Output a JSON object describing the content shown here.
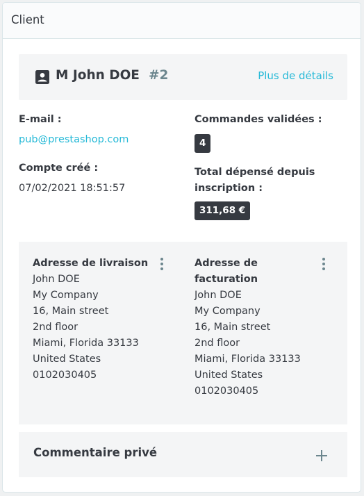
{
  "header": {
    "title": "Client"
  },
  "customer": {
    "name": "M John DOE",
    "id": "#2",
    "details_link": "Plus de détails",
    "icon": "account-box-icon"
  },
  "info": {
    "email_label": "E-mail :",
    "email_value": "pub@prestashop.com",
    "created_label": "Compte créé :",
    "created_value": "07/02/2021 18:51:57",
    "orders_label": "Commandes validées :",
    "orders_value": "4",
    "total_label_line1": "Total dépensé depuis",
    "total_label_line2": "inscription :",
    "total_value": "311,68 €"
  },
  "addresses": {
    "delivery": {
      "title": "Adresse de livraison",
      "lines": [
        "John DOE",
        "My Company",
        "16, Main street",
        "2nd floor",
        "Miami, Florida 33133",
        "United States",
        "0102030405"
      ]
    },
    "invoice": {
      "title_line1": "Adresse de",
      "title_line2": "facturation",
      "lines": [
        "John DOE",
        "My Company",
        "16, Main street",
        "2nd floor",
        "Miami, Florida 33133",
        "United States",
        "0102030405"
      ]
    },
    "menu_icon": "more-vert-icon"
  },
  "comment": {
    "title": "Commentaire privé",
    "add_icon": "plus-icon"
  },
  "colors": {
    "accent": "#25b9d7",
    "text": "#363a41",
    "muted": "#6c868e",
    "panel_bg": "#f4f5f6",
    "badge_bg": "#363a41"
  }
}
